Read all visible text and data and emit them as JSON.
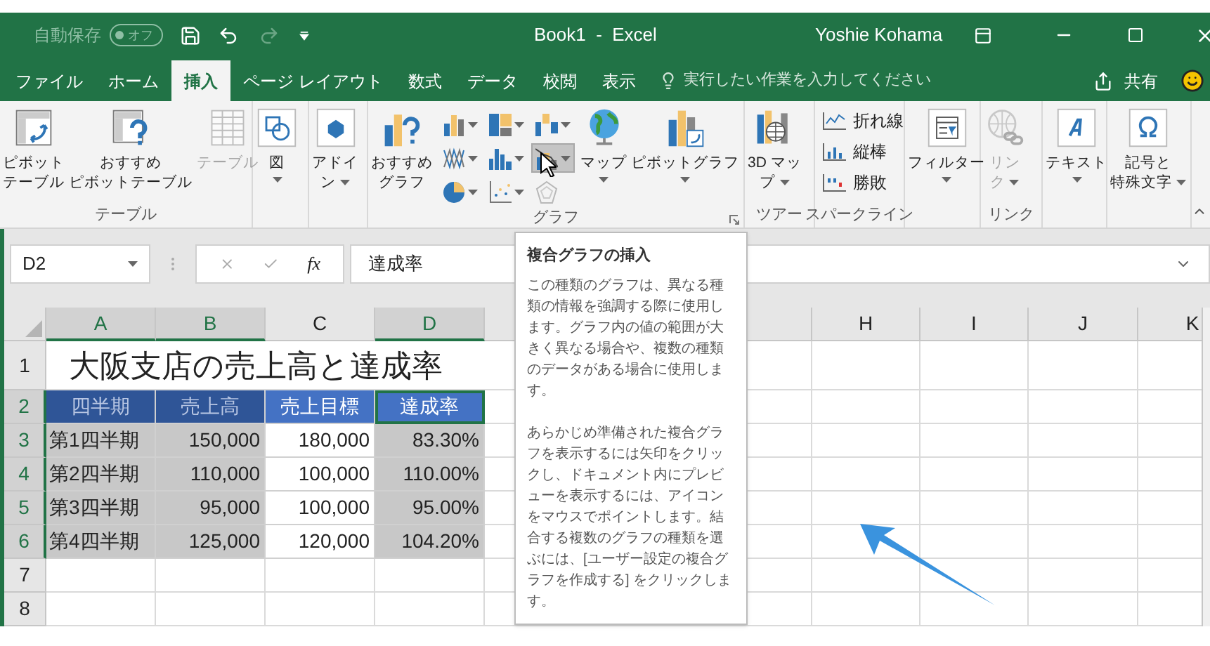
{
  "title_bar": {
    "autosave": {
      "label": "自動保存",
      "state": "オフ",
      "on": false
    },
    "document_title": "Book1  -  Excel",
    "user": "Yoshie Kohama"
  },
  "ribbon_tabs": [
    {
      "label": "ファイル",
      "selected": false
    },
    {
      "label": "ホーム",
      "selected": false
    },
    {
      "label": "挿入",
      "selected": true
    },
    {
      "label": "ページ レイアウト",
      "selected": false
    },
    {
      "label": "数式",
      "selected": false
    },
    {
      "label": "データ",
      "selected": false
    },
    {
      "label": "校閲",
      "selected": false
    },
    {
      "label": "表示",
      "selected": false
    }
  ],
  "tell_me": {
    "placeholder": "実行したい作業を入力してください"
  },
  "share_button": "共有",
  "ribbon_groups": [
    {
      "label": "テーブル",
      "items": [
        {
          "kind": "large",
          "lines": [
            "ピボット",
            "テーブル"
          ],
          "dropdown": false,
          "disabled": false
        },
        {
          "kind": "large",
          "lines": [
            "おすすめ",
            "ピボットテーブル"
          ],
          "dropdown": false,
          "disabled": false
        },
        {
          "kind": "large",
          "lines": [
            "テーブル"
          ],
          "dropdown": false,
          "disabled": true
        }
      ]
    },
    {
      "items": [
        {
          "kind": "large",
          "lines": [
            "図"
          ],
          "dropdown": true,
          "disabled": false
        }
      ]
    },
    {
      "items": [
        {
          "kind": "large",
          "lines": [
            "アドイ",
            "ン"
          ],
          "dropdown": true,
          "disabled": false
        }
      ]
    },
    {
      "label": "グラフ",
      "launcher": true,
      "items": [
        {
          "kind": "large",
          "lines": [
            "おすすめ",
            "グラフ"
          ],
          "dropdown": false,
          "disabled": false
        },
        {
          "kind": "chart_grid",
          "buttons": [
            {
              "dropdown": true,
              "hovered": false,
              "disabled": false
            },
            {
              "dropdown": true,
              "hovered": false,
              "disabled": false
            },
            {
              "dropdown": true,
              "hovered": false,
              "disabled": false
            },
            {
              "dropdown": true,
              "hovered": false,
              "disabled": false
            },
            {
              "dropdown": true,
              "hovered": false,
              "disabled": false
            },
            {
              "dropdown": true,
              "hovered": true,
              "disabled": false
            },
            {
              "dropdown": true,
              "hovered": false,
              "disabled": false
            },
            {
              "dropdown": true,
              "hovered": false,
              "disabled": false
            },
            {
              "dropdown": false,
              "hovered": false,
              "disabled": true
            }
          ]
        },
        {
          "kind": "large",
          "lines": [
            "マップ"
          ],
          "dropdown": true,
          "disabled": false
        },
        {
          "kind": "large",
          "lines": [
            "ピボットグラフ"
          ],
          "dropdown": true,
          "disabled": false
        }
      ]
    },
    {
      "label": "ツアー",
      "items": [
        {
          "kind": "large",
          "lines": [
            "3D マッ",
            "プ"
          ],
          "dropdown": true,
          "disabled": false
        }
      ]
    },
    {
      "label": "スパークライン",
      "items": [
        {
          "kind": "small_list",
          "buttons": [
            {
              "label": "折れ線"
            },
            {
              "label": "縦棒"
            },
            {
              "label": "勝敗"
            }
          ]
        }
      ]
    },
    {
      "items": [
        {
          "kind": "large",
          "lines": [
            "フィルター"
          ],
          "dropdown": true,
          "disabled": false
        }
      ]
    },
    {
      "label": "リンク",
      "items": [
        {
          "kind": "large",
          "lines": [
            "リン",
            "ク"
          ],
          "dropdown": true,
          "disabled": true
        }
      ]
    },
    {
      "items": [
        {
          "kind": "large",
          "lines": [
            "テキスト"
          ],
          "dropdown": true,
          "disabled": false
        }
      ]
    },
    {
      "items": [
        {
          "kind": "large",
          "lines": [
            "記号と",
            "特殊文字"
          ],
          "dropdown": true,
          "disabled": false
        }
      ]
    }
  ],
  "formula_bar": {
    "name_box": "D2",
    "fx_label": "fx",
    "value": "達成率"
  },
  "columns": [
    {
      "label": "A",
      "selected": true
    },
    {
      "label": "B",
      "selected": true
    },
    {
      "label": "C",
      "selected": false
    },
    {
      "label": "D",
      "selected": true
    },
    {},
    {},
    {},
    {
      "label": "H",
      "selected": false
    },
    {
      "label": "I",
      "selected": false
    },
    {
      "label": "J",
      "selected": false
    },
    {
      "label": "K",
      "selected": false
    }
  ],
  "rows": [
    {
      "number": "1",
      "selected": false,
      "title": "大阪支店の売上高と達成率"
    },
    {
      "number": "2",
      "selected": true,
      "cells": [
        {
          "kind": "header",
          "text": "四半期",
          "selected": true,
          "active": false
        },
        {
          "kind": "header",
          "text": "売上高",
          "selected": true,
          "active": false
        },
        {
          "kind": "header",
          "text": "売上目標",
          "selected": false,
          "active": false
        },
        {
          "kind": "header",
          "text": "達成率",
          "selected": true,
          "active": true
        }
      ]
    },
    {
      "number": "3",
      "selected": true,
      "cells": [
        {
          "kind": "data",
          "text": "第1四半期",
          "selected": true
        },
        {
          "kind": "data",
          "text": "150,000",
          "selected": true
        },
        {
          "kind": "data",
          "text": "180,000",
          "selected": false
        },
        {
          "kind": "data",
          "text": "83.30%",
          "selected": true
        }
      ]
    },
    {
      "number": "4",
      "selected": true,
      "cells": [
        {
          "kind": "data",
          "text": "第2四半期",
          "selected": true
        },
        {
          "kind": "data",
          "text": "110,000",
          "selected": true
        },
        {
          "kind": "data",
          "text": "100,000",
          "selected": false
        },
        {
          "kind": "data",
          "text": "110.00%",
          "selected": true
        }
      ]
    },
    {
      "number": "5",
      "selected": true,
      "cells": [
        {
          "kind": "data",
          "text": "第3四半期",
          "selected": true
        },
        {
          "kind": "data",
          "text": "95,000",
          "selected": true
        },
        {
          "kind": "data",
          "text": "100,000",
          "selected": false
        },
        {
          "kind": "data",
          "text": "95.00%",
          "selected": true
        }
      ]
    },
    {
      "number": "6",
      "selected": true,
      "cells": [
        {
          "kind": "data",
          "text": "第4四半期",
          "selected": true
        },
        {
          "kind": "data",
          "text": "125,000",
          "selected": true
        },
        {
          "kind": "data",
          "text": "120,000",
          "selected": false
        },
        {
          "kind": "data",
          "text": "104.20%",
          "selected": true
        }
      ]
    },
    {
      "number": "7",
      "selected": false
    },
    {
      "number": "8",
      "selected": false
    }
  ],
  "tooltip": {
    "title": "複合グラフの挿入",
    "paragraphs": [
      "この種類のグラフは、異なる種類の情報を強調する際に使用します。グラフ内の値の範囲が大きく異なる場合や、複数の種類のデータがある場合に使用します。",
      "あらかじめ準備された複合グラフを表示するには矢印をクリックし、ドキュメント内にプレビューを表示するには、アイコンをマウスでポイントします。結合する複数のグラフの種類を選ぶには、[ユーザー設定の複合グラフを作成する] をクリックします。"
    ]
  }
}
